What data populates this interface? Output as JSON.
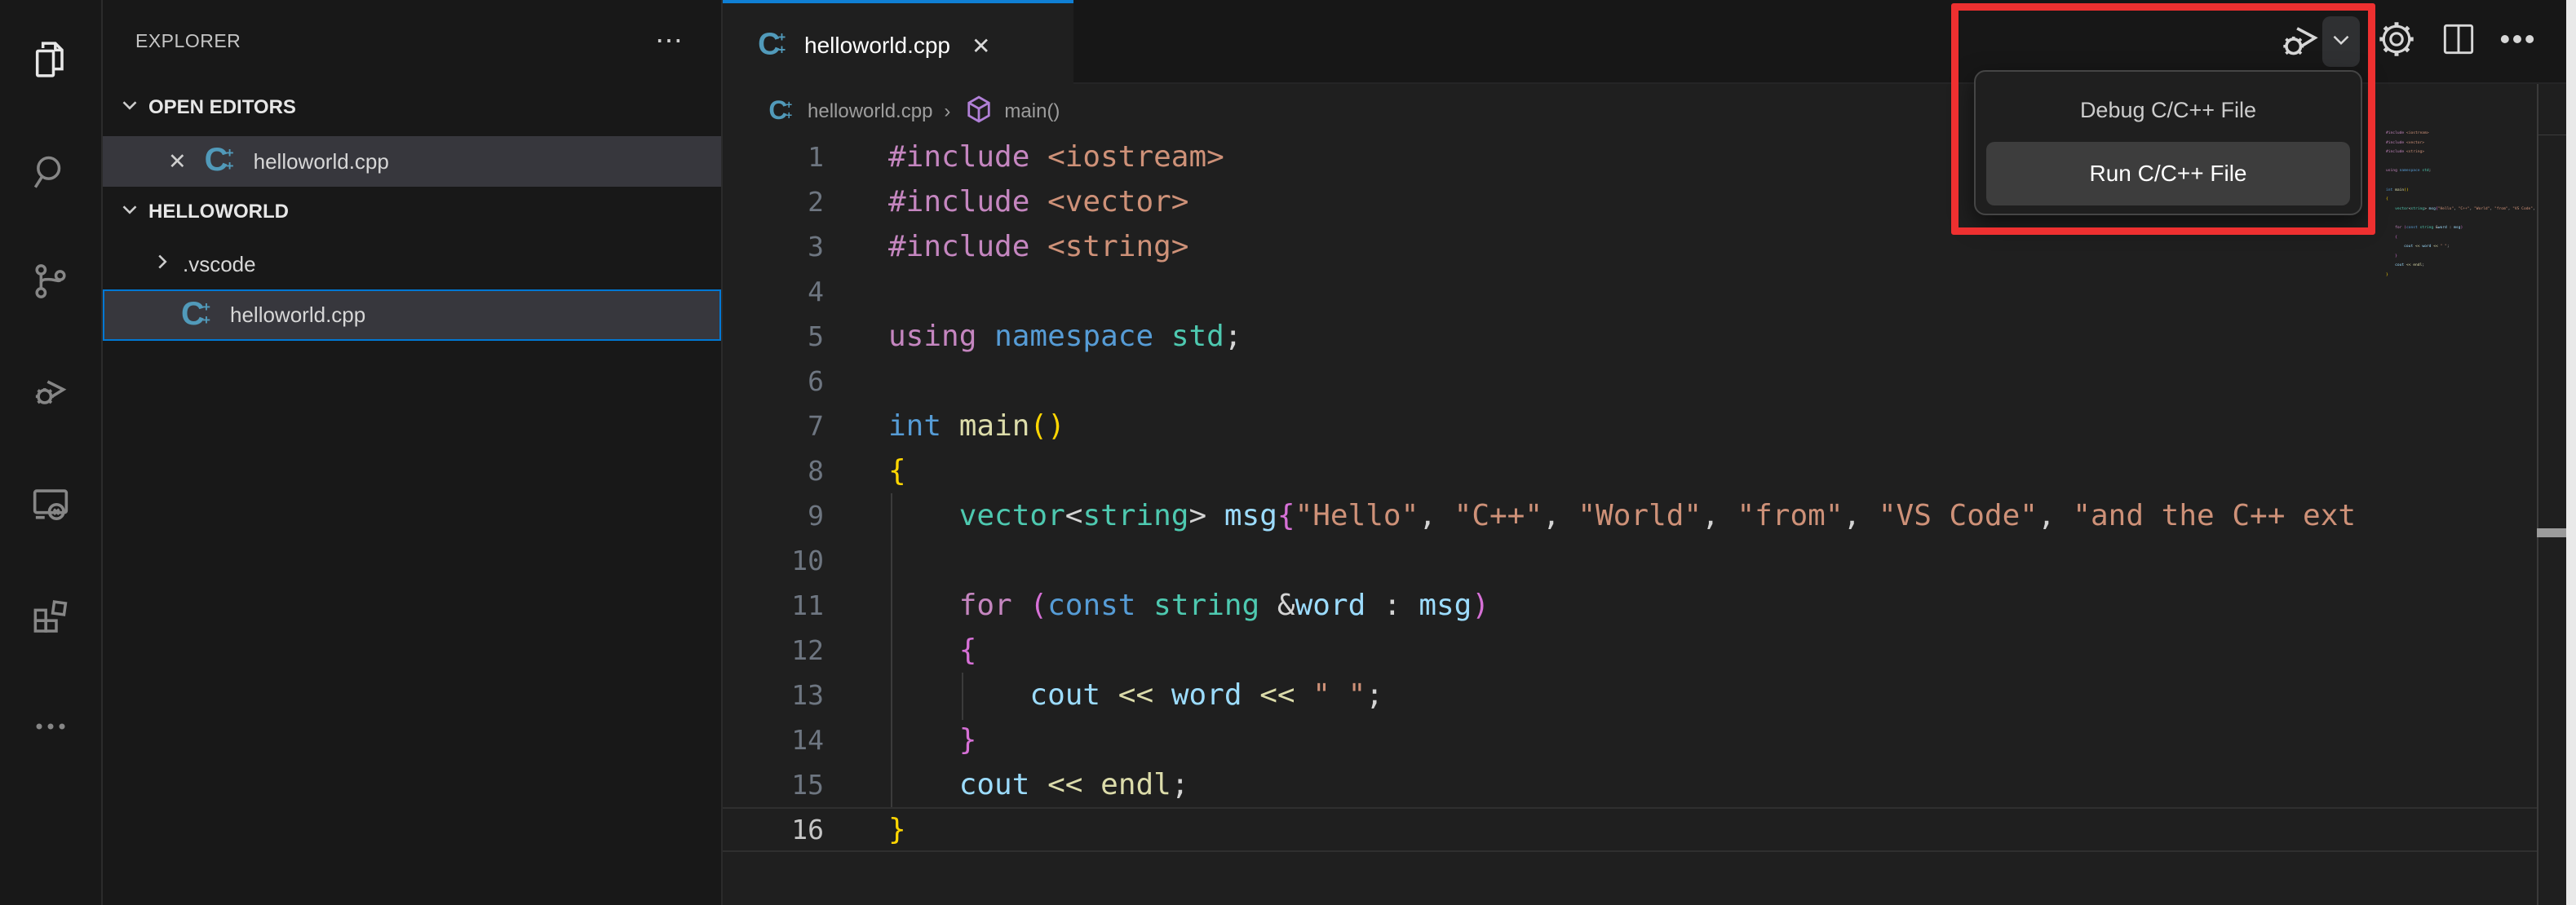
{
  "colors": {
    "accent": "#0078d4",
    "annotation_red": "#ee3030",
    "selection_bg": "#37373d",
    "editor_bg": "#1f1f1f",
    "chrome_bg": "#181818",
    "cpp_icon_blue": "#519aba",
    "symbol_purple": "#B180D7"
  },
  "activity_bar": {
    "items": [
      {
        "id": "explorer",
        "icon": "files-icon",
        "active": true
      },
      {
        "id": "search",
        "icon": "search-icon",
        "active": false
      },
      {
        "id": "source-control",
        "icon": "branch-icon",
        "active": false
      },
      {
        "id": "run-debug",
        "icon": "debug-play-icon",
        "active": false
      },
      {
        "id": "remote-explorer",
        "icon": "remote-monitor-icon",
        "active": false
      },
      {
        "id": "extensions",
        "icon": "extensions-icon",
        "active": false
      },
      {
        "id": "more",
        "icon": "ellipsis-icon",
        "active": false
      }
    ]
  },
  "sidebar": {
    "title": "EXPLORER",
    "open_editors": {
      "label": "OPEN EDITORS",
      "item": {
        "file": "helloworld.cpp",
        "close": "✕"
      }
    },
    "folder_section": {
      "label": "HELLOWORLD",
      "items": [
        {
          "label": ".vscode",
          "type": "folder"
        },
        {
          "label": "helloworld.cpp",
          "type": "cpp-file",
          "selected": true
        }
      ]
    }
  },
  "tab": {
    "title": "helloworld.cpp",
    "close": "✕"
  },
  "breadcrumb": {
    "file": "helloworld.cpp",
    "separator": "›",
    "symbol": "main()"
  },
  "actions": {
    "run_debug": "debug-play-icon",
    "dropdown": "chevron-down-icon",
    "settings": "gear-icon",
    "split": "split-editor-icon",
    "more": "ellipsis-icon"
  },
  "menu": {
    "items": [
      {
        "label": "Debug C/C++ File",
        "highlighted": false
      },
      {
        "label": "Run C/C++ File",
        "highlighted": true
      }
    ]
  },
  "editor": {
    "current_line": 16,
    "lines": [
      {
        "n": 1,
        "t": [
          [
            "kw",
            "#include"
          ],
          [
            "pl",
            " "
          ],
          [
            "st",
            "<iostream>"
          ]
        ]
      },
      {
        "n": 2,
        "t": [
          [
            "kw",
            "#include"
          ],
          [
            "pl",
            " "
          ],
          [
            "st",
            "<vector>"
          ]
        ]
      },
      {
        "n": 3,
        "t": [
          [
            "kw",
            "#include"
          ],
          [
            "pl",
            " "
          ],
          [
            "st",
            "<string>"
          ]
        ]
      },
      {
        "n": 4,
        "t": []
      },
      {
        "n": 5,
        "t": [
          [
            "kw",
            "using"
          ],
          [
            "pl",
            " "
          ],
          [
            "ty",
            "namespace"
          ],
          [
            "pl",
            " "
          ],
          [
            "cl",
            "std"
          ],
          [
            "pl",
            ";"
          ]
        ]
      },
      {
        "n": 6,
        "t": []
      },
      {
        "n": 7,
        "t": [
          [
            "ty",
            "int"
          ],
          [
            "pl",
            " "
          ],
          [
            "fn",
            "main"
          ],
          [
            "b1",
            "()"
          ]
        ]
      },
      {
        "n": 8,
        "t": [
          [
            "b1",
            "{"
          ]
        ]
      },
      {
        "n": 9,
        "t": [
          [
            "pl",
            "    "
          ],
          [
            "cl",
            "vector"
          ],
          [
            "pl",
            "<"
          ],
          [
            "cl",
            "string"
          ],
          [
            "pl",
            "> "
          ],
          [
            "vr",
            "msg"
          ],
          [
            "b2",
            "{"
          ],
          [
            "st",
            "\"Hello\""
          ],
          [
            "pl",
            ", "
          ],
          [
            "st",
            "\"C++\""
          ],
          [
            "pl",
            ", "
          ],
          [
            "st",
            "\"World\""
          ],
          [
            "pl",
            ", "
          ],
          [
            "st",
            "\"from\""
          ],
          [
            "pl",
            ", "
          ],
          [
            "st",
            "\"VS Code\""
          ],
          [
            "pl",
            ", "
          ],
          [
            "st",
            "\"and the C++ ext"
          ]
        ]
      },
      {
        "n": 10,
        "t": []
      },
      {
        "n": 11,
        "t": [
          [
            "pl",
            "    "
          ],
          [
            "kw",
            "for"
          ],
          [
            "pl",
            " "
          ],
          [
            "b2",
            "("
          ],
          [
            "ty",
            "const"
          ],
          [
            "pl",
            " "
          ],
          [
            "cl",
            "string"
          ],
          [
            "pl",
            " &"
          ],
          [
            "vr",
            "word"
          ],
          [
            "pl",
            " : "
          ],
          [
            "vr",
            "msg"
          ],
          [
            "b2",
            ")"
          ]
        ]
      },
      {
        "n": 12,
        "t": [
          [
            "pl",
            "    "
          ],
          [
            "b2",
            "{"
          ]
        ]
      },
      {
        "n": 13,
        "t": [
          [
            "pl",
            "        "
          ],
          [
            "vr",
            "cout"
          ],
          [
            "pl",
            " "
          ],
          [
            "fn",
            "<<"
          ],
          [
            "pl",
            " "
          ],
          [
            "vr",
            "word"
          ],
          [
            "pl",
            " "
          ],
          [
            "fn",
            "<<"
          ],
          [
            "pl",
            " "
          ],
          [
            "st",
            "\" \""
          ],
          [
            "pl",
            ";"
          ]
        ]
      },
      {
        "n": 14,
        "t": [
          [
            "pl",
            "    "
          ],
          [
            "b2",
            "}"
          ]
        ]
      },
      {
        "n": 15,
        "t": [
          [
            "pl",
            "    "
          ],
          [
            "vr",
            "cout"
          ],
          [
            "pl",
            " "
          ],
          [
            "fn",
            "<<"
          ],
          [
            "pl",
            " "
          ],
          [
            "fn",
            "endl"
          ],
          [
            "pl",
            ";"
          ]
        ]
      },
      {
        "n": 16,
        "t": [
          [
            "b1",
            "}"
          ]
        ]
      }
    ]
  }
}
